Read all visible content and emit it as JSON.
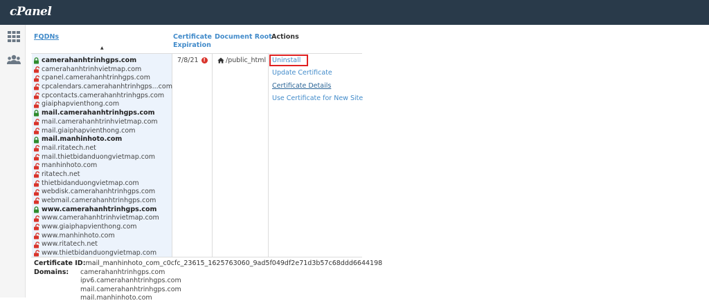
{
  "app": {
    "logo": "cPanel"
  },
  "sidebar": {
    "items": [
      {
        "icon": "grid-icon"
      },
      {
        "icon": "users-icon"
      }
    ]
  },
  "table": {
    "headers": {
      "fqdns": "FQDNs",
      "cert_line1": "Certificate",
      "cert_line2": "Expiration",
      "doc_root": "Document Root",
      "actions": "Actions"
    },
    "fqdns": [
      {
        "name": "camerahanhtrinhgps.com",
        "secure": true
      },
      {
        "name": "camerahanhtrinhvietmap.com",
        "secure": false
      },
      {
        "name": "cpanel.camerahanhtrinhgps.com",
        "secure": false
      },
      {
        "name": "cpcalendars.camerahanhtrinhgps...com",
        "secure": false
      },
      {
        "name": "cpcontacts.camerahanhtrinhgps.com",
        "secure": false
      },
      {
        "name": "giaiphapvienthong.com",
        "secure": false
      },
      {
        "name": "mail.camerahanhtrinhgps.com",
        "secure": true
      },
      {
        "name": "mail.camerahanhtrinhvietmap.com",
        "secure": false
      },
      {
        "name": "mail.giaiphapvienthong.com",
        "secure": false
      },
      {
        "name": "mail.manhinhoto.com",
        "secure": true
      },
      {
        "name": "mail.ritatech.net",
        "secure": false
      },
      {
        "name": "mail.thietbidanduongvietmap.com",
        "secure": false
      },
      {
        "name": "manhinhoto.com",
        "secure": false
      },
      {
        "name": "ritatech.net",
        "secure": false
      },
      {
        "name": "thietbidanduongvietmap.com",
        "secure": false
      },
      {
        "name": "webdisk.camerahanhtrinhgps.com",
        "secure": false
      },
      {
        "name": "webmail.camerahanhtrinhgps.com",
        "secure": false
      },
      {
        "name": "www.camerahanhtrinhgps.com",
        "secure": true
      },
      {
        "name": "www.camerahanhtrinhvietmap.com",
        "secure": false
      },
      {
        "name": "www.giaiphapvienthong.com",
        "secure": false
      },
      {
        "name": "www.manhinhoto.com",
        "secure": false
      },
      {
        "name": "www.ritatech.net",
        "secure": false
      },
      {
        "name": "www.thietbidanduongvietmap.com",
        "secure": false
      }
    ],
    "expiration": "7/8/21",
    "warning_glyph": "!",
    "doc_root": "/public_html",
    "actions": {
      "uninstall": "Uninstall",
      "update": "Update Certificate",
      "details": "Certificate Details",
      "use_new_site": "Use Certificate for New Site"
    }
  },
  "detail": {
    "cert_id_label": "Certificate ID:",
    "cert_id": "mail_manhinhoto_com_c0cfc_23615_1625763060_9ad5f049df2e71d3b57c68ddd6644198",
    "domains_label": "Domains:",
    "domains": [
      "camerahanhtrinhgps.com",
      "ipv6.camerahanhtrinhgps.com",
      "mail.camerahanhtrinhgps.com",
      "mail.manhinhoto.com"
    ]
  },
  "colors": {
    "topbar": "#293a4a",
    "link": "#428bca",
    "lock_secure": "#2e8b2e",
    "lock_insecure": "#d9332b",
    "highlight_box": "#e02020"
  }
}
